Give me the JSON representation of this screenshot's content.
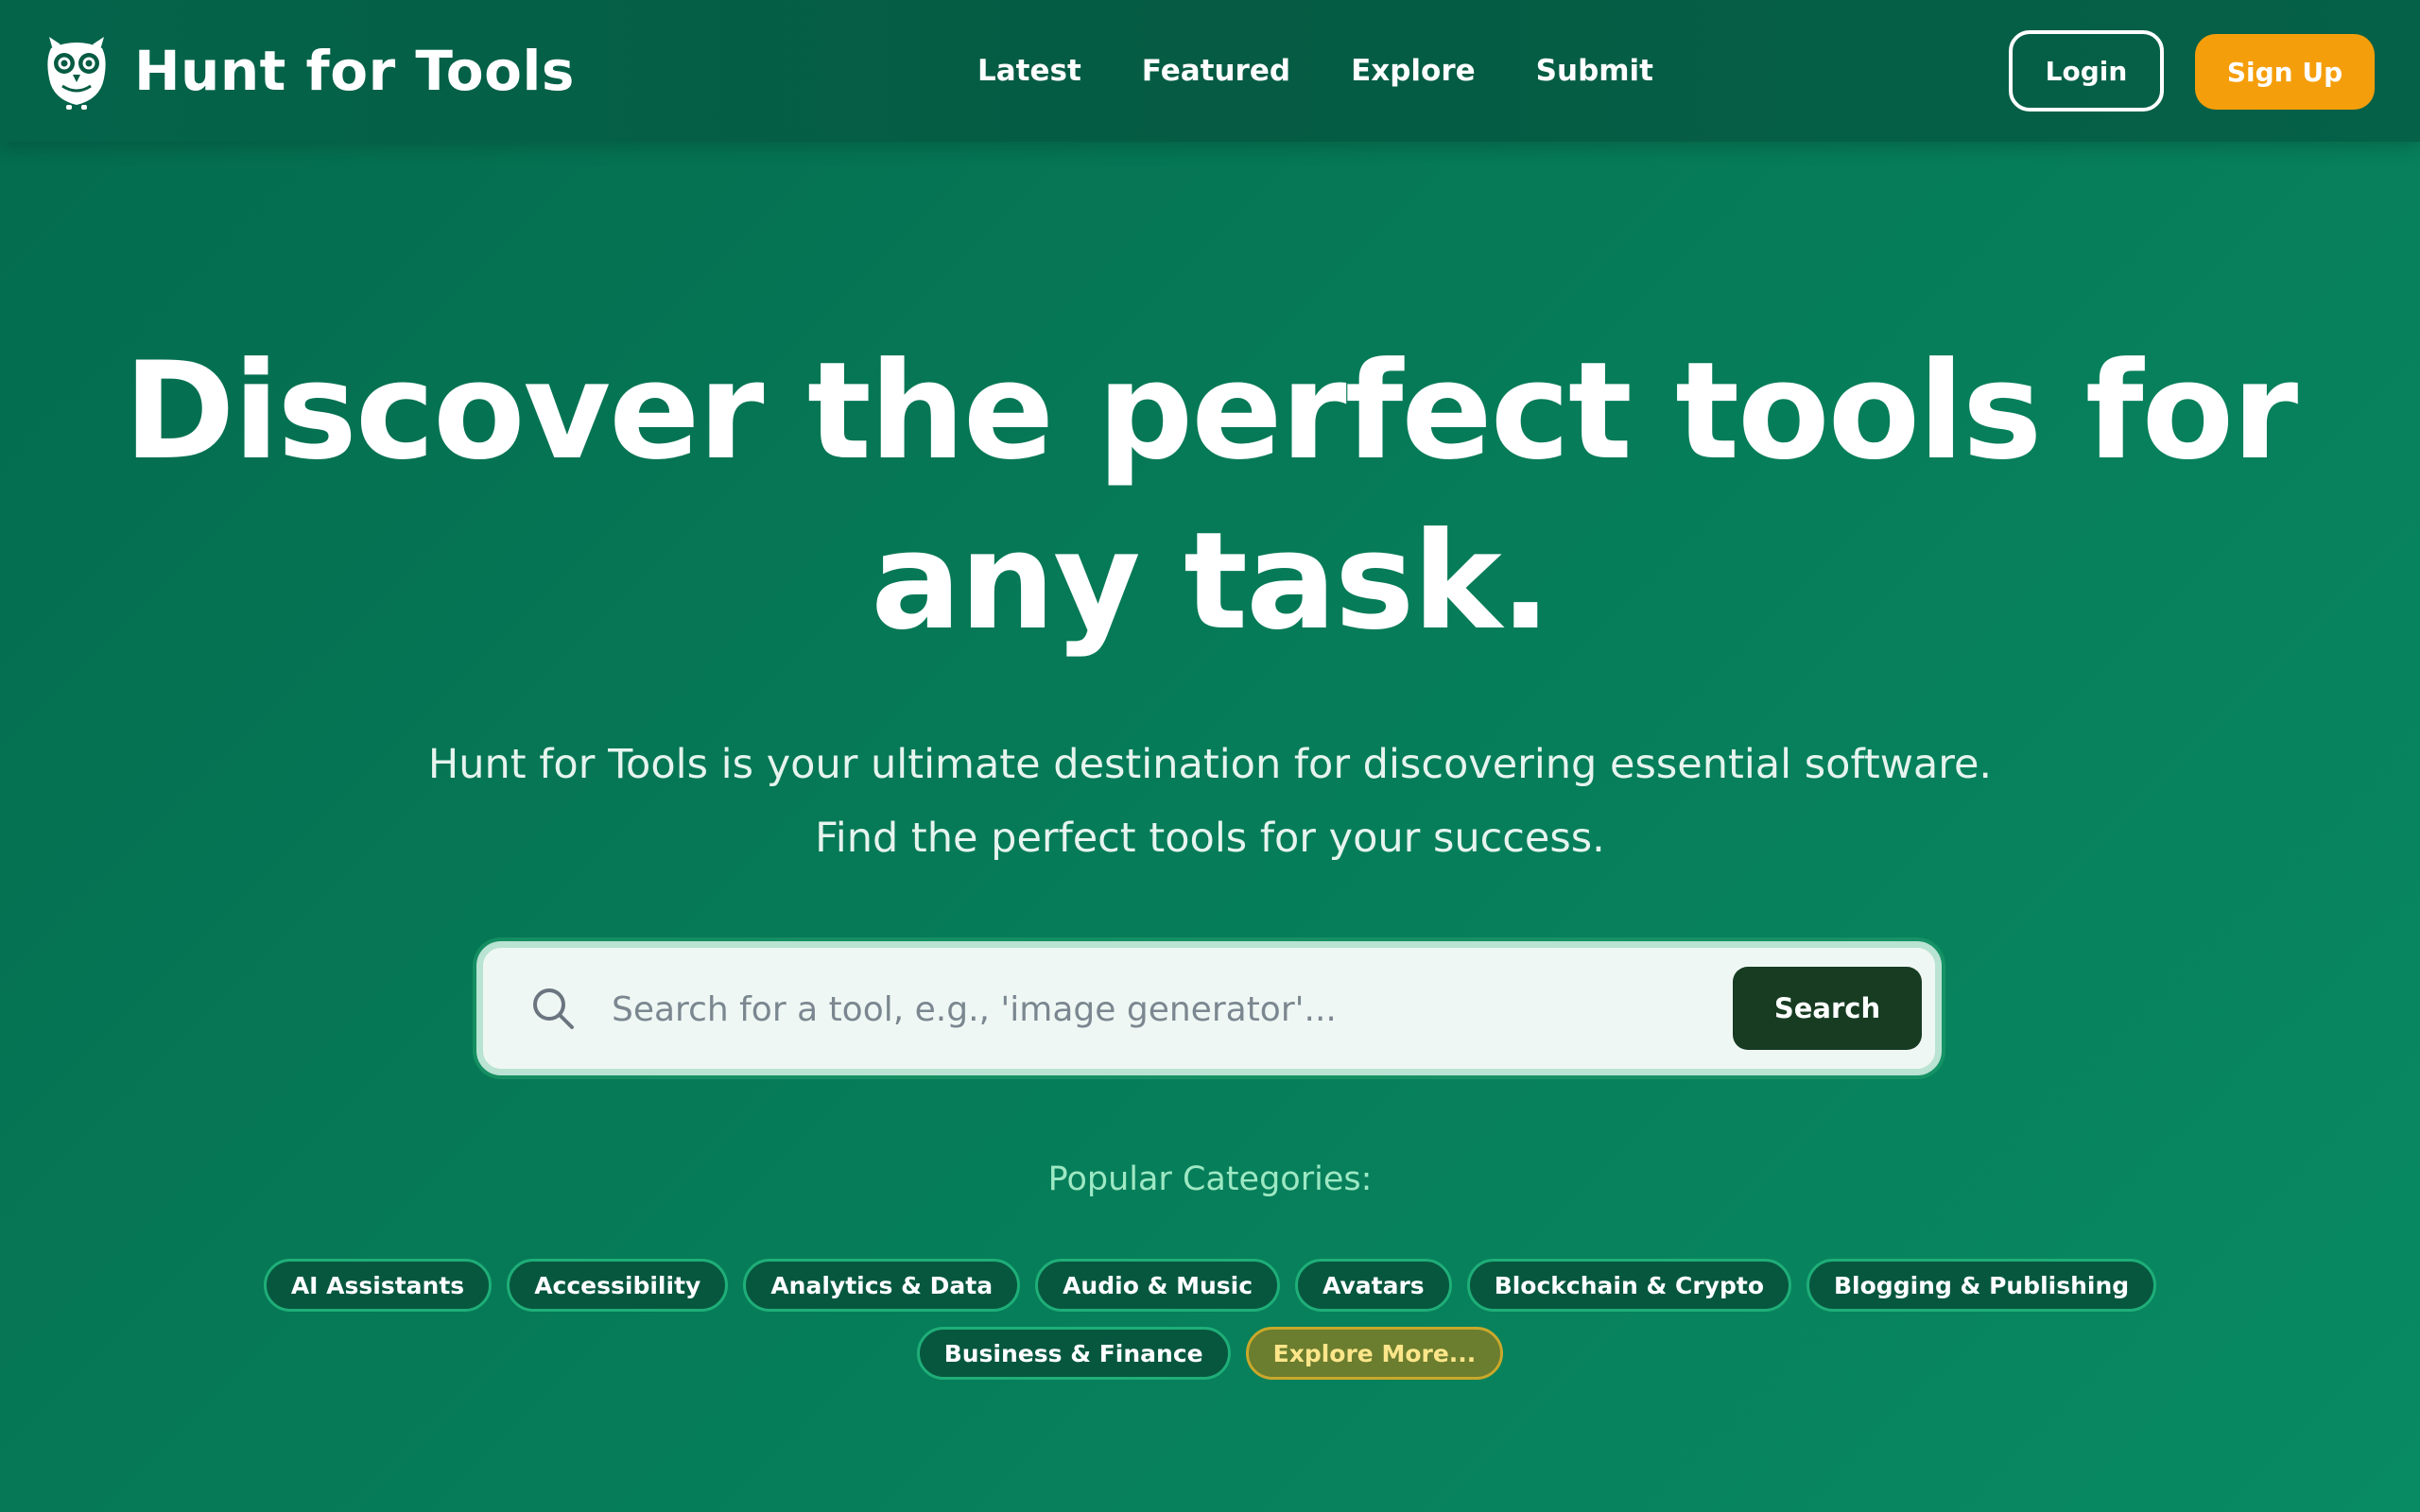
{
  "brand": {
    "name": "Hunt for Tools",
    "logo_icon": "owl-icon"
  },
  "nav": {
    "links": [
      "Latest",
      "Featured",
      "Explore",
      "Submit"
    ],
    "login_label": "Login",
    "signup_label": "Sign Up"
  },
  "hero": {
    "title": "Discover the perfect tools for any task.",
    "subtitle_line1": "Hunt for Tools is your ultimate destination for discovering essential software.",
    "subtitle_line2": "Find the perfect tools for your success."
  },
  "search": {
    "placeholder": "Search for a tool, e.g., 'image generator'...",
    "value": "",
    "button_label": "Search",
    "icon": "search-icon"
  },
  "categories": {
    "heading": "Popular Categories:",
    "items": [
      "AI Assistants",
      "Accessibility",
      "Analytics & Data",
      "Audio & Music",
      "Avatars",
      "Blockchain & Crypto",
      "Blogging & Publishing",
      "Business & Finance"
    ],
    "more_label": "Explore More..."
  },
  "colors": {
    "primary_green": "#067a57",
    "header_green": "#055b43",
    "signup_orange": "#f59e0b",
    "search_button": "#173c22",
    "chip_border": "#1fae78",
    "more_chip_text": "#fde68a"
  }
}
